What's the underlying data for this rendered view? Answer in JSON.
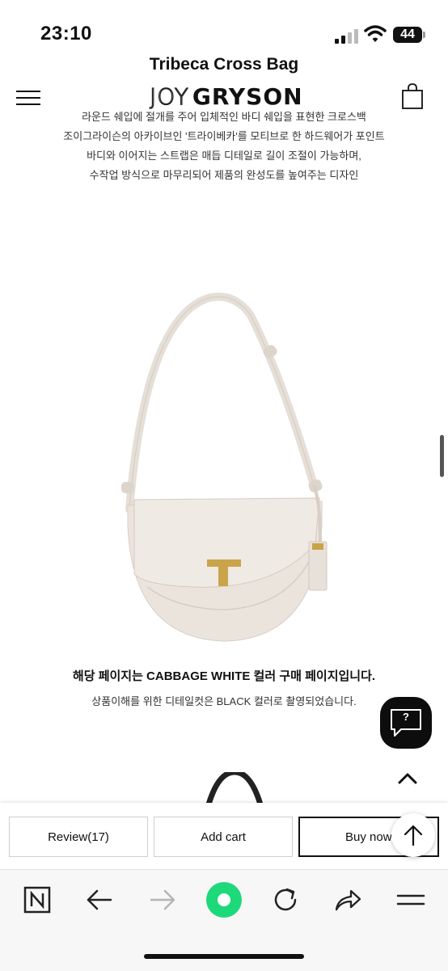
{
  "status_bar": {
    "time": "23:10",
    "battery": "44"
  },
  "header": {
    "page_heading": "Tribeca Cross Bag",
    "logo_part1": "JOY",
    "logo_part2": "GRYSON"
  },
  "description": [
    "라운드 쉐입에 절개를 주어 입체적인 바디 쉐입을 표현한 크로스백",
    "조이그라이슨의 아카이브인 '트라이베카'를 모티브로 한 하드웨어가 포인트",
    "바디와 이어지는 스트랩은 매듭 디테일로 길이 조절이 가능하며,",
    "수작업 방식으로 마무리되어 제품의 완성도를 높여주는 디자인"
  ],
  "notices": {
    "color_notice": "해당 페이지는 CABBAGE WHITE 컬러 구매 페이지입니다.",
    "photo_notice": "상품이해를 위한 디테일컷은 BLACK 컬러로 촬영되었습니다."
  },
  "chat": {
    "icon_text": "?"
  },
  "actions": {
    "review_label": "Review(17)",
    "cart_label": "Add cart",
    "buy_label": "Buy now"
  },
  "colors": {
    "bag": "#ebe4dd",
    "hardware": "#c9a44a",
    "browser_green": "#1ed97a"
  },
  "icons": [
    "signal-icon",
    "wifi-icon",
    "battery-icon",
    "menu-icon",
    "shopping-bag-icon",
    "chat-icon",
    "chevron-up-icon",
    "arrow-up-icon",
    "naver-n-icon",
    "back-arrow-icon",
    "forward-arrow-icon",
    "green-home-icon",
    "refresh-icon",
    "share-icon",
    "browser-menu-icon"
  ]
}
